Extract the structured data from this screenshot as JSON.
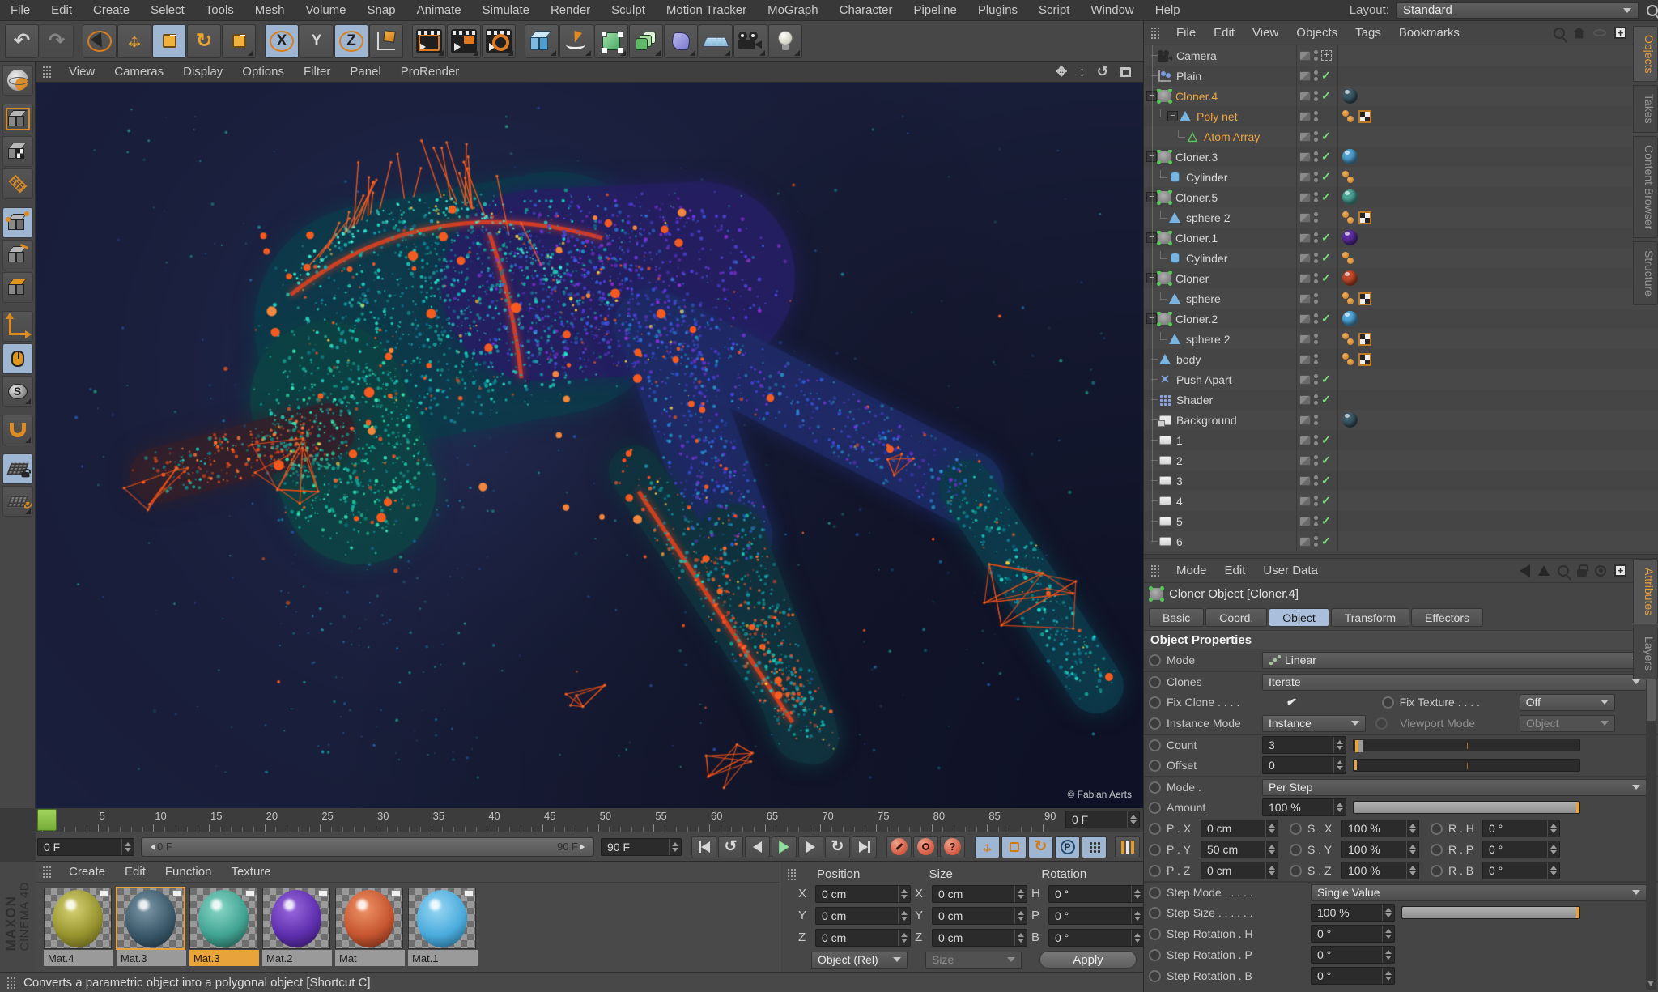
{
  "menu_bar": {
    "items": [
      "File",
      "Edit",
      "Create",
      "Select",
      "Tools",
      "Mesh",
      "Volume",
      "Snap",
      "Animate",
      "Simulate",
      "Render",
      "Sculpt",
      "Motion Tracker",
      "MoGraph",
      "Character",
      "Pipeline",
      "Plugins",
      "Script",
      "Window",
      "Help"
    ],
    "layout_label": "Layout:",
    "layout_value": "Standard"
  },
  "toolbar": {
    "axis_x": "X",
    "axis_y": "Y",
    "axis_z": "Z",
    "icons": [
      "undo",
      "redo",
      "live-selection",
      "move",
      "scale",
      "rotate",
      "last-tool-scale",
      "lock-x-axis",
      "lock-y-axis",
      "lock-z-axis",
      "coordinate-system",
      "render-view",
      "render-picture-viewer",
      "render-settings",
      "add-primitive-cube",
      "spline-pen",
      "subdivision-surface",
      "array-instance",
      "deformer",
      "floor-environment",
      "camera",
      "light"
    ]
  },
  "left_toolbar": {
    "s_label": "S",
    "icons": [
      "make-editable",
      "model-mode",
      "texture-mode",
      "workplane-mode",
      "points-mode",
      "edges-mode",
      "polygons-mode",
      "axis-mode",
      "viewport-solo",
      "snap-s",
      "snap-magnet",
      "lock-workplane",
      "workplane-rotate"
    ]
  },
  "viewport": {
    "menu": [
      "View",
      "Cameras",
      "Display",
      "Options",
      "Filter",
      "Panel",
      "ProRender"
    ],
    "credit": "© Fabian Aerts",
    "palette": {
      "bg": "#1a1f3c",
      "teal": [
        "#17c5b4",
        "#1fd4c8",
        "#12a3b8",
        "#0c7f96",
        "#27e0c8",
        "#129e8e"
      ],
      "tealgreen": [
        "#18cdb2",
        "#2ee3a4",
        "#14b79e",
        "#0e8f8a",
        "#35e8b8"
      ],
      "purpleblue": [
        "#6c33e0",
        "#5340e8",
        "#3b55e0",
        "#8a2fd8",
        "#4a43d0",
        "#2f6fd8"
      ],
      "bluepurple": [
        "#2f55d8",
        "#4a3fd8",
        "#6c33d0",
        "#2f7fd8",
        "#1f98c8"
      ],
      "orangeteal": [
        "#ff5a22",
        "#ff7a33",
        "#18c5b4",
        "#0e8f96",
        "#e84818"
      ],
      "tealred": [
        "#17c5b4",
        "#0e96a0",
        "#ff4a22",
        "#12a3b8",
        "#ff6a2e"
      ],
      "ambient": [
        "#1db8c8",
        "#1f8fd8",
        "#24d8a8",
        "#2a6ae0",
        "#15a090"
      ],
      "orange": "#ff5a1f",
      "yellow": "#ffd43a"
    }
  },
  "object_manager": {
    "menu": [
      "File",
      "Edit",
      "View",
      "Objects",
      "Tags",
      "Bookmarks"
    ],
    "header_icons": [
      "search-icon",
      "home-icon",
      "eye-icon",
      "add-panel-icon"
    ],
    "side_tabs": [
      "Objects",
      "Takes",
      "Content Browser",
      "Structure"
    ],
    "active_side_tab": "Objects",
    "items": [
      {
        "name": "Camera",
        "icon": "camera",
        "toggle": "target",
        "tags": []
      },
      {
        "name": "Plain",
        "icon": "plain",
        "toggle": "check",
        "tags": []
      },
      {
        "name": "Cloner.4",
        "icon": "cloner",
        "expand": true,
        "selected": true,
        "toggle": "check",
        "tags": [
          {
            "type": "material",
            "color": "#3d5a68"
          }
        ]
      },
      {
        "name": "Poly net",
        "icon": "polygon",
        "depth": 1,
        "expand": true,
        "selected": true,
        "toggle": "none",
        "tags": [
          {
            "type": "dots"
          },
          {
            "type": "checker"
          }
        ]
      },
      {
        "name": "Atom Array",
        "icon": "atom",
        "depth": 2,
        "selected": true,
        "toggle": "check",
        "tags": []
      },
      {
        "name": "Cloner.3",
        "icon": "cloner",
        "expand": true,
        "toggle": "check",
        "tags": [
          {
            "type": "material",
            "color": "#4f9fd0"
          }
        ]
      },
      {
        "name": "Cylinder",
        "icon": "cylinder",
        "depth": 1,
        "toggle": "check",
        "tags": [
          {
            "type": "dots"
          }
        ]
      },
      {
        "name": "Cloner.5",
        "icon": "cloner",
        "expand": true,
        "toggle": "check",
        "tags": [
          {
            "type": "material",
            "color": "#49a493"
          }
        ]
      },
      {
        "name": "sphere 2",
        "icon": "polygon",
        "depth": 1,
        "toggle": "none",
        "tags": [
          {
            "type": "dots"
          },
          {
            "type": "checker"
          }
        ]
      },
      {
        "name": "Cloner.1",
        "icon": "cloner",
        "expand": true,
        "toggle": "check",
        "tags": [
          {
            "type": "material",
            "color": "#5c2d9f"
          }
        ]
      },
      {
        "name": "Cylinder",
        "icon": "cylinder",
        "depth": 1,
        "toggle": "check",
        "tags": [
          {
            "type": "dots"
          }
        ]
      },
      {
        "name": "Cloner",
        "icon": "cloner",
        "expand": true,
        "toggle": "check",
        "tags": [
          {
            "type": "material",
            "color": "#c04a2c"
          }
        ]
      },
      {
        "name": "sphere",
        "icon": "polygon",
        "depth": 1,
        "toggle": "none",
        "tags": [
          {
            "type": "dots"
          },
          {
            "type": "checker"
          }
        ]
      },
      {
        "name": "Cloner.2",
        "icon": "cloner",
        "expand": true,
        "toggle": "check",
        "tags": [
          {
            "type": "material",
            "color": "#4da6d9"
          }
        ]
      },
      {
        "name": "sphere 2",
        "icon": "polygon",
        "depth": 1,
        "toggle": "none",
        "tags": [
          {
            "type": "dots"
          },
          {
            "type": "checker"
          }
        ]
      },
      {
        "name": "body",
        "icon": "polygon",
        "toggle": "none",
        "tags": [
          {
            "type": "dots"
          },
          {
            "type": "checker"
          }
        ]
      },
      {
        "name": "Push Apart",
        "icon": "push-apart",
        "toggle": "check",
        "tags": []
      },
      {
        "name": "Shader",
        "icon": "shader",
        "toggle": "check",
        "tags": []
      },
      {
        "name": "Background",
        "icon": "background",
        "toggle": "none",
        "tags": [
          {
            "type": "material",
            "color": "#3d5a68"
          }
        ]
      },
      {
        "name": "1",
        "icon": "plane",
        "toggle": "check",
        "tags": []
      },
      {
        "name": "2",
        "icon": "plane",
        "toggle": "check",
        "tags": []
      },
      {
        "name": "3",
        "icon": "plane",
        "toggle": "check",
        "tags": []
      },
      {
        "name": "4",
        "icon": "plane",
        "toggle": "check",
        "tags": []
      },
      {
        "name": "5",
        "icon": "plane",
        "toggle": "check",
        "tags": []
      },
      {
        "name": "6",
        "icon": "plane",
        "toggle": "check",
        "tags": []
      }
    ]
  },
  "attributes": {
    "menu": [
      "Mode",
      "Edit",
      "User Data"
    ],
    "header_icons": [
      "back-icon",
      "up-pointer-icon",
      "search-icon",
      "lock-icon",
      "target-icon",
      "add-panel-icon"
    ],
    "title": "Cloner Object [Cloner.4]",
    "tabs": [
      "Basic",
      "Coord.",
      "Object",
      "Transform",
      "Effectors"
    ],
    "active_tab": "Object",
    "section": "Object Properties",
    "side_tabs": [
      "Attributes",
      "Layers"
    ],
    "active_side_tab": "Attributes",
    "rows": [
      {
        "type": "dropdown",
        "label": "Mode",
        "value": "Linear",
        "icon": "linear"
      },
      {
        "type": "dropdown",
        "label": "Clones",
        "value": "Iterate",
        "sep": true
      },
      {
        "type": "check_dropdown",
        "label": "Fix Clone . . . .",
        "checked": true,
        "label2": "Fix Texture . . . .",
        "value2": "Off"
      },
      {
        "type": "dual_dropdown",
        "label": "Instance Mode",
        "value": "Instance",
        "label2": "Viewport Mode",
        "value2": "Object"
      },
      {
        "type": "slider",
        "label": "Count",
        "value": "3",
        "handle": "block",
        "sep": true
      },
      {
        "type": "slider",
        "label": "Offset",
        "value": "0",
        "handle": "line"
      },
      {
        "type": "dropdown",
        "label": "Mode .",
        "value": "Per Step",
        "sep": true
      },
      {
        "type": "slider",
        "label": "Amount",
        "value": "100 %",
        "handle": "full"
      },
      {
        "type": "triple",
        "cells": [
          {
            "l": "P . X",
            "v": "0 cm"
          },
          {
            "l": "S . X",
            "v": "100 %"
          },
          {
            "l": "R . H",
            "v": "0 °"
          }
        ]
      },
      {
        "type": "triple",
        "cells": [
          {
            "l": "P . Y",
            "v": "50 cm"
          },
          {
            "l": "S . Y",
            "v": "100 %"
          },
          {
            "l": "R . P",
            "v": "0 °"
          }
        ]
      },
      {
        "type": "triple",
        "cells": [
          {
            "l": "P . Z",
            "v": "0 cm"
          },
          {
            "l": "S . Z",
            "v": "100 %"
          },
          {
            "l": "R . B",
            "v": "0 °"
          }
        ]
      },
      {
        "type": "dropdown",
        "label": "Step Mode . . . . .",
        "value": "Single Value",
        "wide": true,
        "sep": true
      },
      {
        "type": "slider",
        "label": "Step Size . . . . . .",
        "value": "100 %",
        "handle": "full",
        "wide": true
      },
      {
        "type": "field",
        "label": "Step Rotation . H",
        "value": "0 °",
        "wide": true
      },
      {
        "type": "field",
        "label": "Step Rotation . P",
        "value": "0 °",
        "wide": true
      },
      {
        "type": "field",
        "label": "Step Rotation . B",
        "value": "0 °",
        "wide": true
      }
    ]
  },
  "timeline": {
    "tick_start": 0,
    "tick_end": 90,
    "label_step": 5,
    "current_frame_field": "0 F",
    "range_start_label": "0 F",
    "range_end_label": "90 F",
    "end_frame_field": "90 F",
    "transport_buttons": [
      "goto-start",
      "play-backward",
      "previous-frame",
      "play-forward",
      "next-frame",
      "loop",
      "goto-end"
    ],
    "record_buttons": [
      "record-keyframe",
      "record-autokey",
      "help"
    ],
    "help_label": "?",
    "key_buttons": [
      "key-position",
      "key-scale",
      "key-rotation",
      "key-parameter",
      "key-point-level"
    ],
    "param_label": "P"
  },
  "materials": {
    "menu": [
      "Create",
      "Edit",
      "Function",
      "Texture"
    ],
    "items": [
      {
        "name": "Mat.4",
        "color": "#97942f",
        "hi": "#d8d476",
        "lo": "#45430f",
        "selected": false,
        "active": false
      },
      {
        "name": "Mat.3",
        "color": "#3a586a",
        "hi": "#7d98a8",
        "lo": "#14222c",
        "selected": true,
        "active": false
      },
      {
        "name": "Mat.3",
        "color": "#41a392",
        "hi": "#8ad8c8",
        "lo": "#153a33",
        "selected": false,
        "active": true
      },
      {
        "name": "Mat.2",
        "color": "#5e2fae",
        "hi": "#9c6ae0",
        "lo": "#220e44",
        "selected": false,
        "active": false
      },
      {
        "name": "Mat",
        "color": "#c55530",
        "hi": "#f09468",
        "lo": "#4e1c0d",
        "selected": false,
        "active": false
      },
      {
        "name": "Mat.1",
        "color": "#4aabdc",
        "hi": "#9ad8f4",
        "lo": "#154460",
        "selected": false,
        "active": false
      }
    ]
  },
  "coordinates": {
    "groups": [
      {
        "title": "Position",
        "axes": [
          "X",
          "Y",
          "Z"
        ],
        "values": [
          "0 cm",
          "0 cm",
          "0 cm"
        ]
      },
      {
        "title": "Size",
        "axes": [
          "X",
          "Y",
          "Z"
        ],
        "values": [
          "0 cm",
          "0 cm",
          "0 cm"
        ]
      },
      {
        "title": "Rotation",
        "axes": [
          "H",
          "P",
          "B"
        ],
        "values": [
          "0 °",
          "0 °",
          "0 °"
        ]
      }
    ],
    "mode_dropdown": "Object (Rel)",
    "size_dropdown": "Size",
    "apply_label": "Apply"
  },
  "status_bar": {
    "text": "Converts a parametric object into a polygonal object [Shortcut C]"
  },
  "branding": {
    "line1": "MAXON",
    "line2": "CINEMA 4D"
  }
}
